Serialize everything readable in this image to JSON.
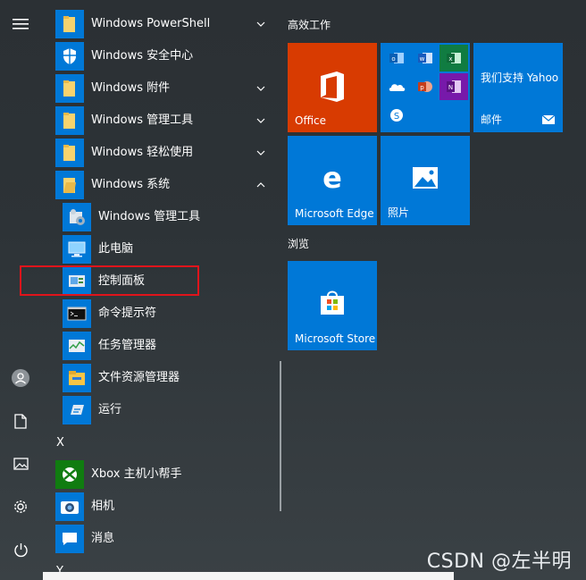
{
  "start_menu": {
    "rail": {
      "menu_icon": "hamburger-icon",
      "items": [
        "user-avatar-icon",
        "documents-icon",
        "pictures-icon",
        "settings-icon",
        "power-icon"
      ]
    },
    "app_list": {
      "items": [
        {
          "label": "Windows PowerShell",
          "icon": "folder-icon",
          "expand": "chevron-down"
        },
        {
          "label": "Windows 安全中心",
          "icon": "shield-icon",
          "expand": ""
        },
        {
          "label": "Windows 附件",
          "icon": "folder-icon",
          "expand": "chevron-down"
        },
        {
          "label": "Windows 管理工具",
          "icon": "folder-icon",
          "expand": "chevron-down"
        },
        {
          "label": "Windows 轻松使用",
          "icon": "folder-icon",
          "expand": "chevron-down"
        },
        {
          "label": "Windows 系统",
          "icon": "folder-open-icon",
          "expand": "chevron-up"
        }
      ],
      "sub_items": [
        {
          "label": "Windows 管理工具",
          "icon": "admin-tools-icon"
        },
        {
          "label": "此电脑",
          "icon": "this-pc-icon"
        },
        {
          "label": "控制面板",
          "icon": "control-panel-icon"
        },
        {
          "label": "命令提示符",
          "icon": "cmd-icon"
        },
        {
          "label": "任务管理器",
          "icon": "task-manager-icon"
        },
        {
          "label": "文件资源管理器",
          "icon": "file-explorer-icon"
        },
        {
          "label": "运行",
          "icon": "run-icon"
        }
      ],
      "letter_x": "X",
      "x_items": [
        {
          "label": "Xbox 主机小帮手",
          "icon": "xbox-icon"
        },
        {
          "label": "相机",
          "icon": "camera-icon"
        },
        {
          "label": "消息",
          "icon": "messages-icon"
        }
      ],
      "letter_y": "Y"
    },
    "tiles": {
      "group1": "高效工作",
      "office": "Office",
      "mail_title": "我们支持 Yahoo",
      "mail_label": "邮件",
      "edge": "Microsoft Edge",
      "photos": "照片",
      "group2": "浏览",
      "store": "Microsoft Store"
    }
  },
  "colors": {
    "tile_blue": "#0078d7",
    "office_orange": "#d83b01",
    "highlight_red": "#e0141b"
  },
  "watermark": "CSDN @左半明"
}
